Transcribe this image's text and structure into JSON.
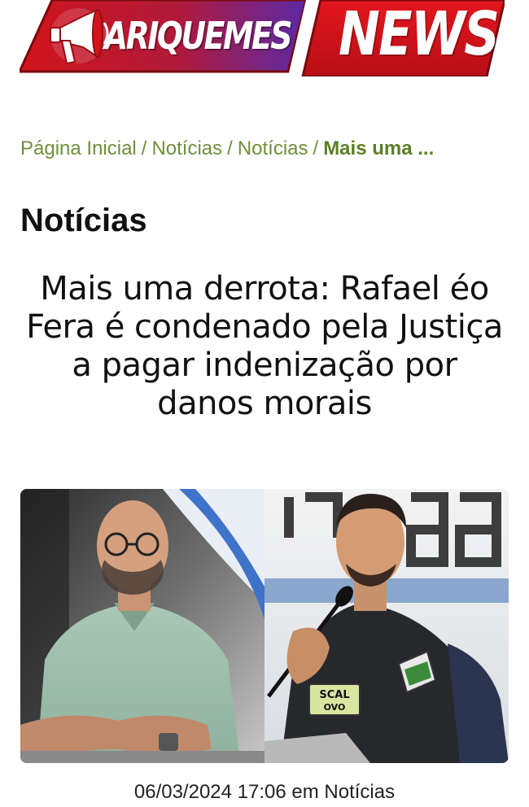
{
  "logo": {
    "left_text": "ARIQUEMES",
    "right_text": "NEWS",
    "icon": "megaphone-icon",
    "colors": {
      "red": "#d2141c",
      "dark_red": "#8e0d12",
      "purple": "#6a2a9e"
    }
  },
  "breadcrumb": {
    "items": [
      "Página Inicial",
      "Notícias",
      "Notícias"
    ],
    "separator": "/",
    "current": "Mais uma ..."
  },
  "section": {
    "title": "Notícias"
  },
  "article": {
    "title": "Mais uma derrota: Rafael éo Fera é condenado pela Justiça a pagar indenização por danos morais",
    "image_badge_text": "SCAL\nOVO",
    "meta": {
      "date": "06/03/2024 17:06",
      "in_label": "em",
      "category": "Notícias"
    }
  },
  "colors": {
    "breadcrumb": "#6f8f3a",
    "text": "#111111"
  }
}
